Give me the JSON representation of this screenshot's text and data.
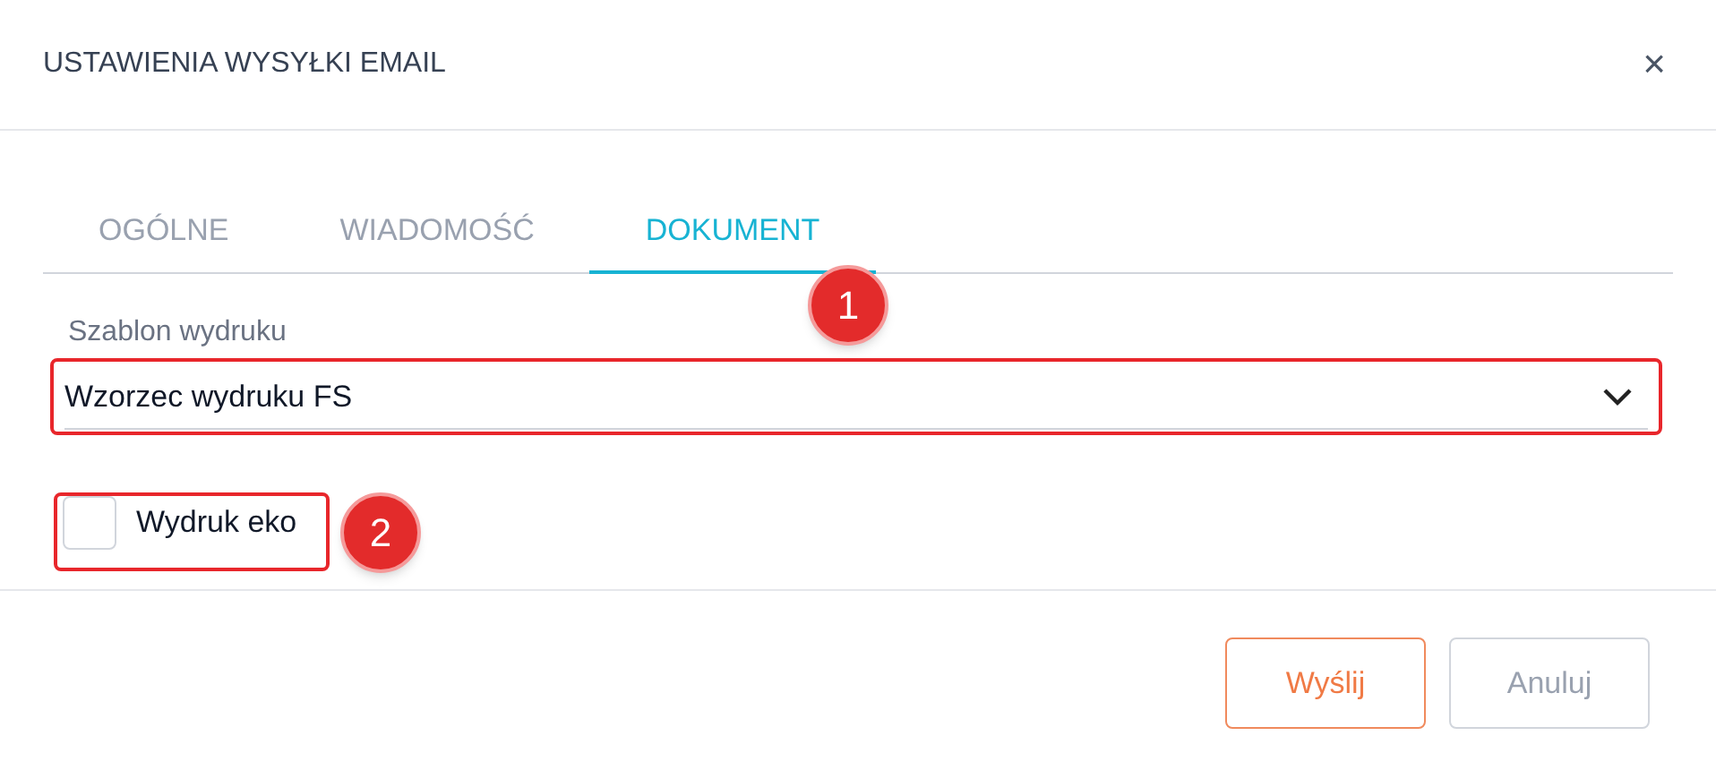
{
  "dialog": {
    "title": "USTAWIENIA WYSYŁKI EMAIL",
    "close": "×"
  },
  "tabs": [
    {
      "label": "OGÓLNE",
      "selected": false
    },
    {
      "label": "WIADOMOŚĆ",
      "selected": false
    },
    {
      "label": "DOKUMENT",
      "selected": true
    }
  ],
  "template": {
    "label": "Szablon wydruku",
    "value": "Wzorzec wydruku FS"
  },
  "eco_print": {
    "label": "Wydruk eko",
    "checked": false
  },
  "buttons": [
    {
      "label": "Wyślij",
      "kind": "primary"
    },
    {
      "label": "Anuluj",
      "kind": "secondary"
    }
  ],
  "annotations": [
    {
      "label": "1"
    },
    {
      "label": "2"
    }
  ]
}
